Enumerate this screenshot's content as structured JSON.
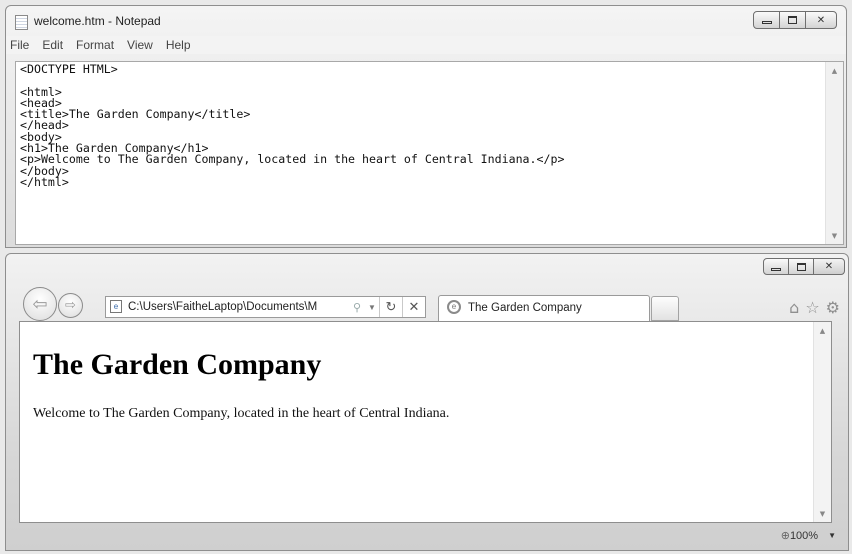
{
  "notepad": {
    "title": "welcome.htm - Notepad",
    "menu": [
      "File",
      "Edit",
      "Format",
      "View",
      "Help"
    ],
    "content": "<DOCTYPE HTML>\n\n<html>\n<head>\n<title>The Garden Company</title>\n</head>\n<body>\n<h1>The Garden Company</h1>\n<p>Welcome to The Garden Company, located in the heart of Central Indiana.</p>\n</body>\n</html>"
  },
  "browser": {
    "address": "C:\\Users\\FaitheLaptop\\Documents\\M",
    "tab_title": "The Garden Company",
    "page": {
      "heading": "The Garden Company",
      "paragraph": "Welcome to The Garden Company, located in the heart of Central Indiana."
    },
    "zoom": "100%"
  },
  "icons": {
    "back": "back-arrow-icon",
    "forward": "forward-arrow-icon",
    "home": "home-icon",
    "favorites": "star-icon",
    "tools": "gear-icon",
    "refresh": "refresh-icon",
    "stop": "stop-icon",
    "search": "search-icon"
  }
}
